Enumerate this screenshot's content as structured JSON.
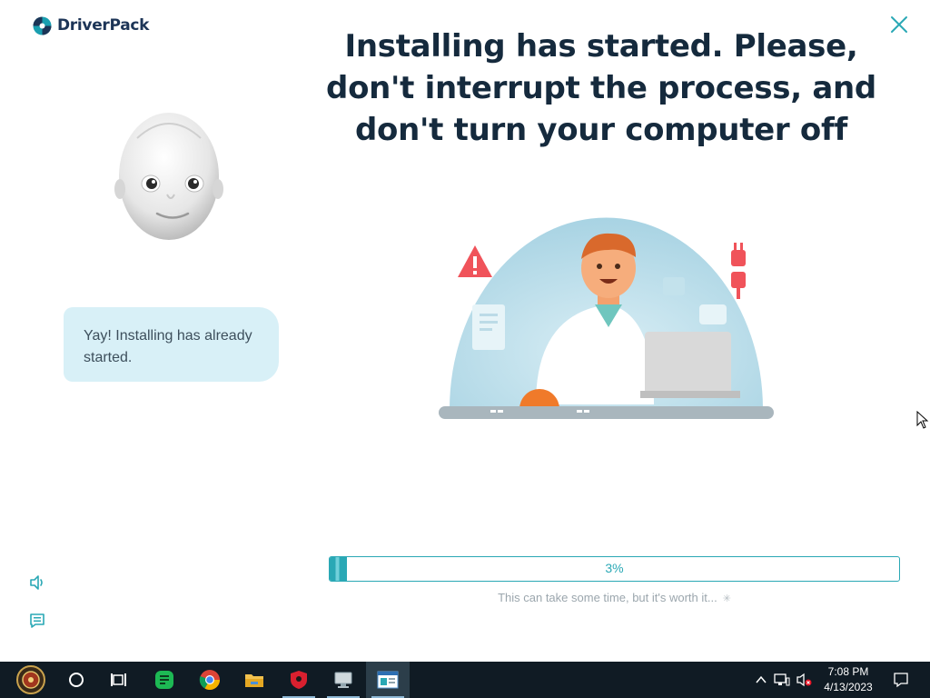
{
  "app": {
    "brand": "DriverPack",
    "headline": "Installing has started. Please, don't interrupt the process, and don't turn your computer off",
    "assistant_message": "Yay! Installing has already started.",
    "progress": {
      "value": 0.03,
      "label": "3%"
    },
    "note": "This can take some time, but it's worth it...",
    "colors": {
      "accent": "#2aa8b5",
      "headline": "#152a3d",
      "bubble": "#d8f0f7",
      "brand": "#1d3557"
    },
    "icons": {
      "close": "close-icon",
      "sound": "speaker-icon",
      "chat": "chat-icon"
    }
  },
  "taskbar": {
    "items": [
      {
        "name": "start-button",
        "icon": "windows-start-icon"
      },
      {
        "name": "search-button",
        "icon": "search-circle-icon"
      },
      {
        "name": "task-view-button",
        "icon": "task-view-icon"
      },
      {
        "name": "notes-app",
        "icon": "green-notes-icon"
      },
      {
        "name": "chrome-app",
        "icon": "chrome-icon"
      },
      {
        "name": "file-explorer-app",
        "icon": "folder-icon"
      },
      {
        "name": "security-app",
        "icon": "shield-icon"
      },
      {
        "name": "driver-app",
        "icon": "computer-icon"
      },
      {
        "name": "driverpack-app",
        "icon": "window-icon",
        "active": true
      }
    ],
    "clock": {
      "time": "7:08 PM",
      "date": "4/13/2023"
    }
  }
}
